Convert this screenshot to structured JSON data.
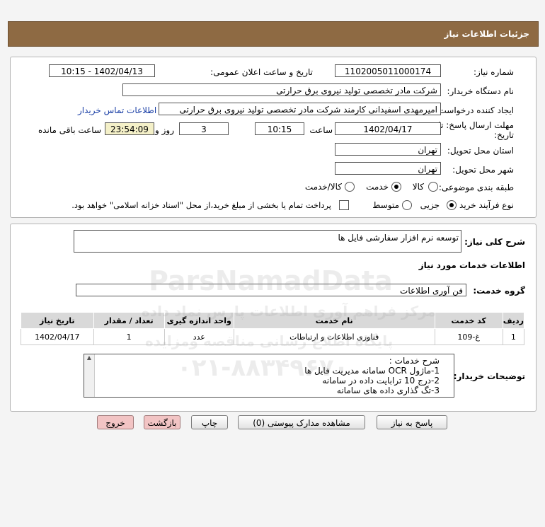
{
  "header": {
    "title": "جزئیات اطلاعات نیاز"
  },
  "form": {
    "need_number_label": "شماره نیاز:",
    "need_number": "1102005011000174",
    "announce_label": "تاریخ و ساعت اعلان عمومی:",
    "announce_value": "1402/04/13 - 10:15",
    "buyer_label": "نام دستگاه خریدار:",
    "buyer_value": "شرکت مادر تخصصی تولید نیروی برق حرارتی",
    "creator_label": "ایجاد کننده درخواست:",
    "creator_value": "امیرمهدی اسفیدانی کارمند شرکت مادر تخصصی تولید نیروی برق حرارتی",
    "contact_link": "اطلاعات تماس خریدار",
    "deadline_label_1": "مهلت ارسال پاسخ: تا",
    "deadline_label_2": "تاریخ:",
    "deadline_date": "1402/04/17",
    "time_label": "ساعت",
    "deadline_time": "10:15",
    "days_value": "3",
    "days_label": "روز و",
    "remaining_value": "23:54:09",
    "remaining_label": "ساعت باقی مانده",
    "province_label": "استان محل تحویل:",
    "province_value": "تهران",
    "city_label": "شهر محل تحویل:",
    "city_value": "تهران",
    "category_label": "طبقه بندی موضوعی:",
    "category_options": [
      "کالا",
      "خدمت",
      "کالا/خدمت"
    ],
    "category_selected": "خدمت",
    "process_label": "نوع فرآیند خرید :",
    "process_options": [
      "جزیی",
      "متوسط"
    ],
    "process_selected": "جزیی",
    "payment_note": "پرداخت تمام یا بخشی از مبلغ خرید،از محل \"اسناد خزانه اسلامی\" خواهد بود."
  },
  "details": {
    "general_desc_label": "شرح کلی نیاز:",
    "general_desc": "توسعه نرم افزار سفارشی فایل ها",
    "services_title": "اطلاعات خدمات مورد نیاز",
    "service_group_label": "گروه خدمت:",
    "service_group_value": "فن آوری اطلاعات",
    "table": {
      "headers": [
        "ردیف",
        "کد خدمت",
        "نام خدمت",
        "واحد اندازه گیری",
        "تعداد / مقدار",
        "تاریخ نیاز"
      ],
      "rows": [
        [
          "1",
          "غ-109",
          "فناوری اطلاعات و ارتباطات",
          "عدد",
          "1",
          "1402/04/17"
        ]
      ]
    },
    "buyer_notes_label": "توضیحات خریدار:",
    "buyer_notes": [
      "شرح خدمات :",
      "1-ماژول OCR سامانه مدیریت فایل ها",
      "2-درج 10 ترابایت داده در سامانه",
      "3-تگ گذاری داده های سامانه"
    ]
  },
  "buttons": {
    "reply": "پاسخ به نیاز",
    "attachments": "مشاهده مدارک پیوستی (0)",
    "print": "چاپ",
    "back": "بازگشت",
    "exit": "خروج"
  },
  "watermark": {
    "line1": "ParsNamadData",
    "line2": "مرکز فراهم آوری اطلاعات پارس نماد داده",
    "line3": "پایگاه اطلاع رسانی مناقصه ومزایده",
    "phone": "۰۲۱-۸۸۳۴۹۶۷۰"
  }
}
